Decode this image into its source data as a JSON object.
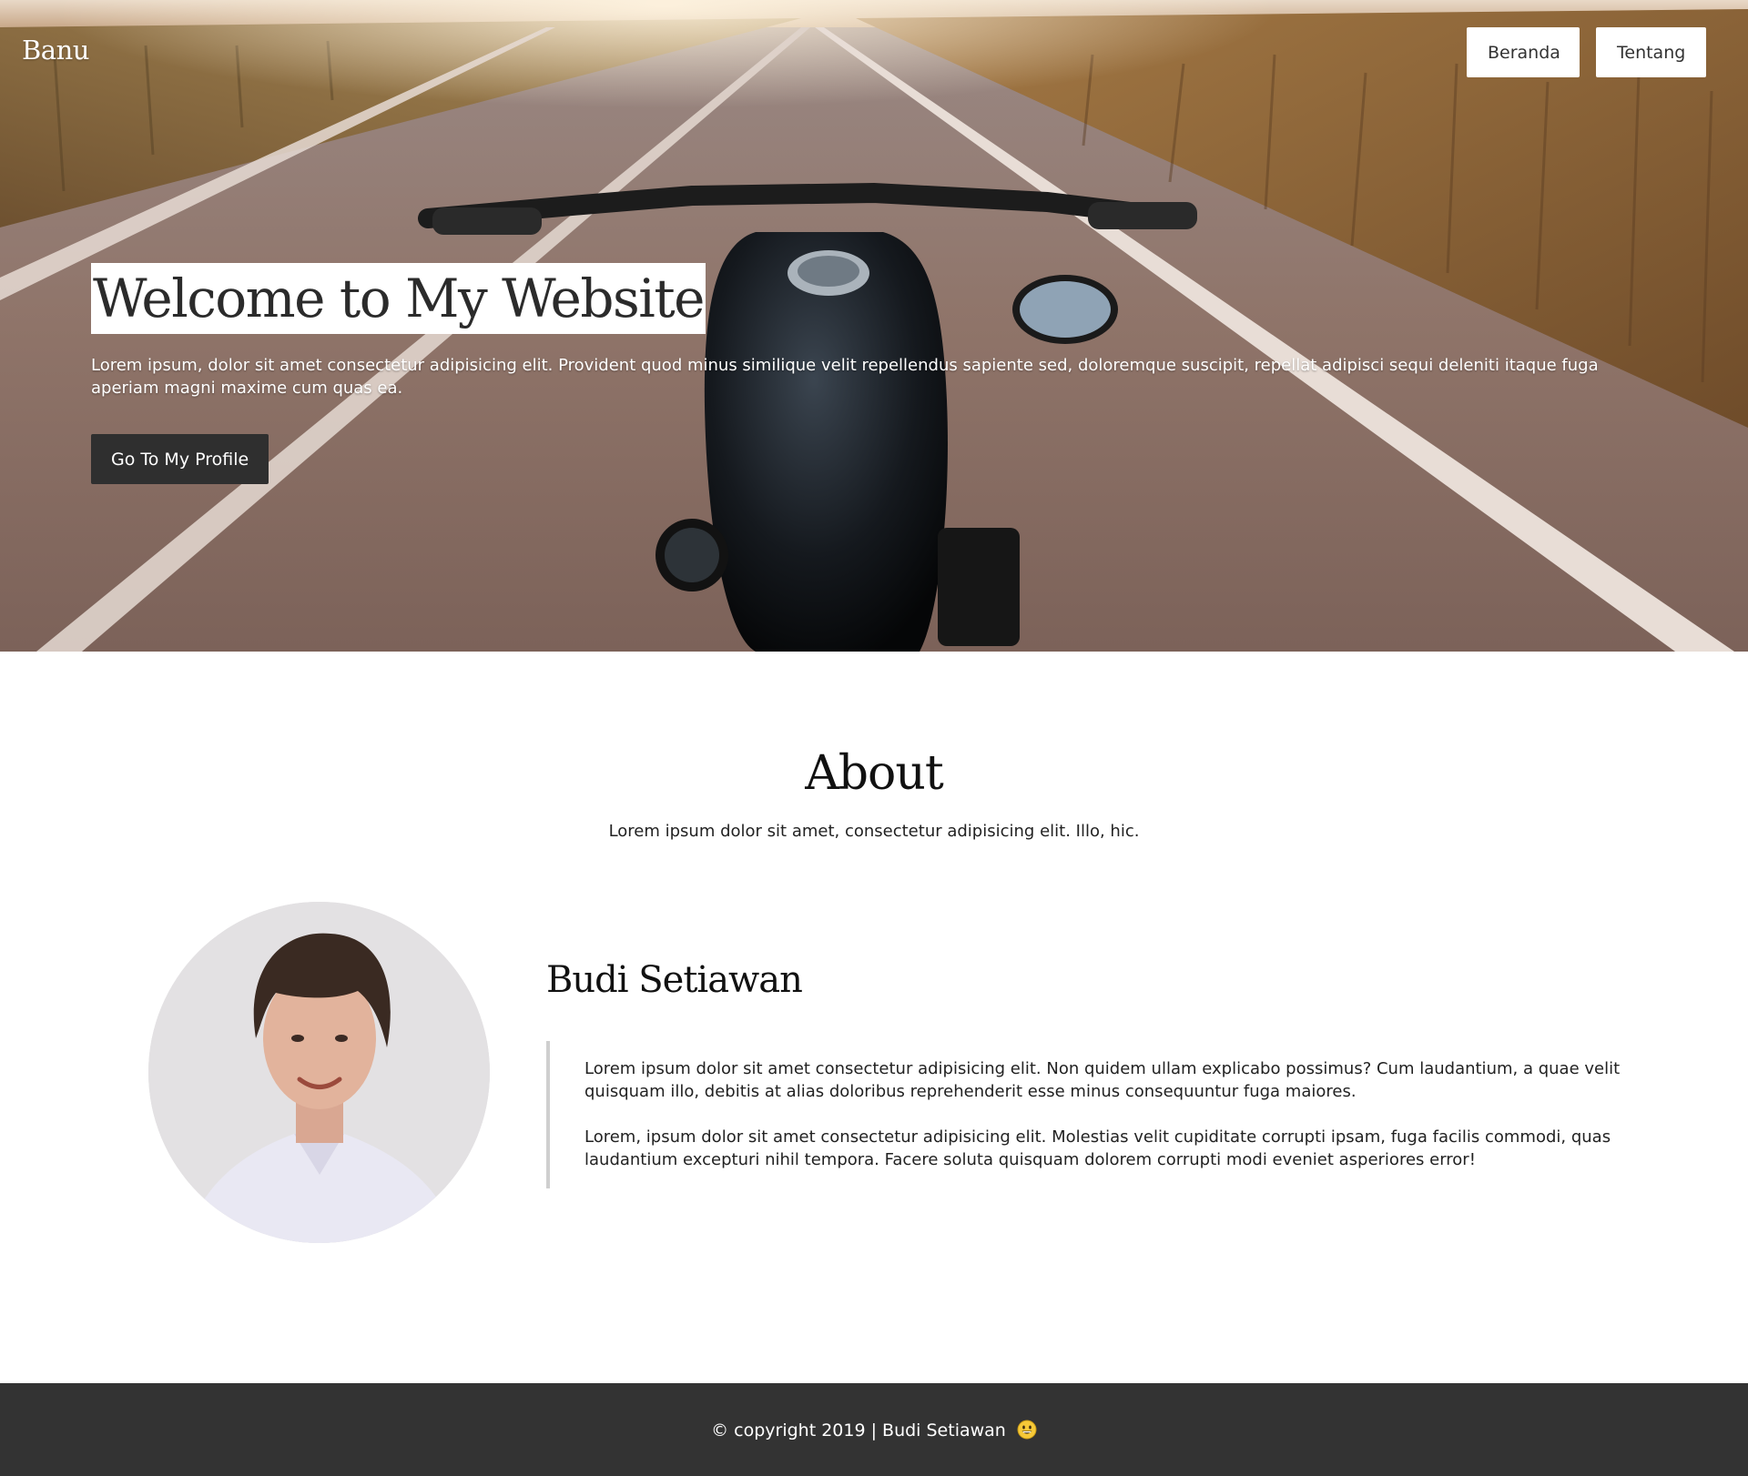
{
  "navbar": {
    "brand": "Banu",
    "links": [
      {
        "label": "Beranda"
      },
      {
        "label": "Tentang"
      }
    ]
  },
  "hero": {
    "title": "Welcome to My Website",
    "text": "Lorem ipsum, dolor sit amet consectetur adipisicing elit. Provident quod minus similique velit repellendus sapiente sed, doloremque suscipit, repellat adipisci sequi deleniti itaque fuga aperiam magni maxime cum quas ea.",
    "cta_label": "Go To My Profile",
    "background_image": "motorcycle-road-photo"
  },
  "about": {
    "title": "About",
    "subtitle": "Lorem ipsum dolor sit amet, consectetur adipisicing elit. Illo, hic.",
    "profile": {
      "name": "Budi Setiawan",
      "avatar_image": "portrait-photo",
      "paragraphs": [
        "Lorem ipsum dolor sit amet consectetur adipisicing elit. Non quidem ullam explicabo possimus? Cum laudantium, a quae velit quisquam illo, debitis at alias doloribus reprehenderit esse minus consequuntur fuga maiores.",
        "Lorem, ipsum dolor sit amet consectetur adipisicing elit. Molestias velit cupiditate corrupti ipsam, fuga facilis commodi, quas laudantium excepturi nihil tempora. Facere soluta quisquam dolorem corrupti modi eveniet asperiores error!"
      ]
    }
  },
  "footer": {
    "text": "© copyright 2019 | Budi Setiawan",
    "emoji_icon": "grinning-face-icon"
  },
  "colors": {
    "footer_bg": "#333333",
    "cta_bg": "#2f2f2f",
    "quote_border": "#cfcfcf"
  }
}
